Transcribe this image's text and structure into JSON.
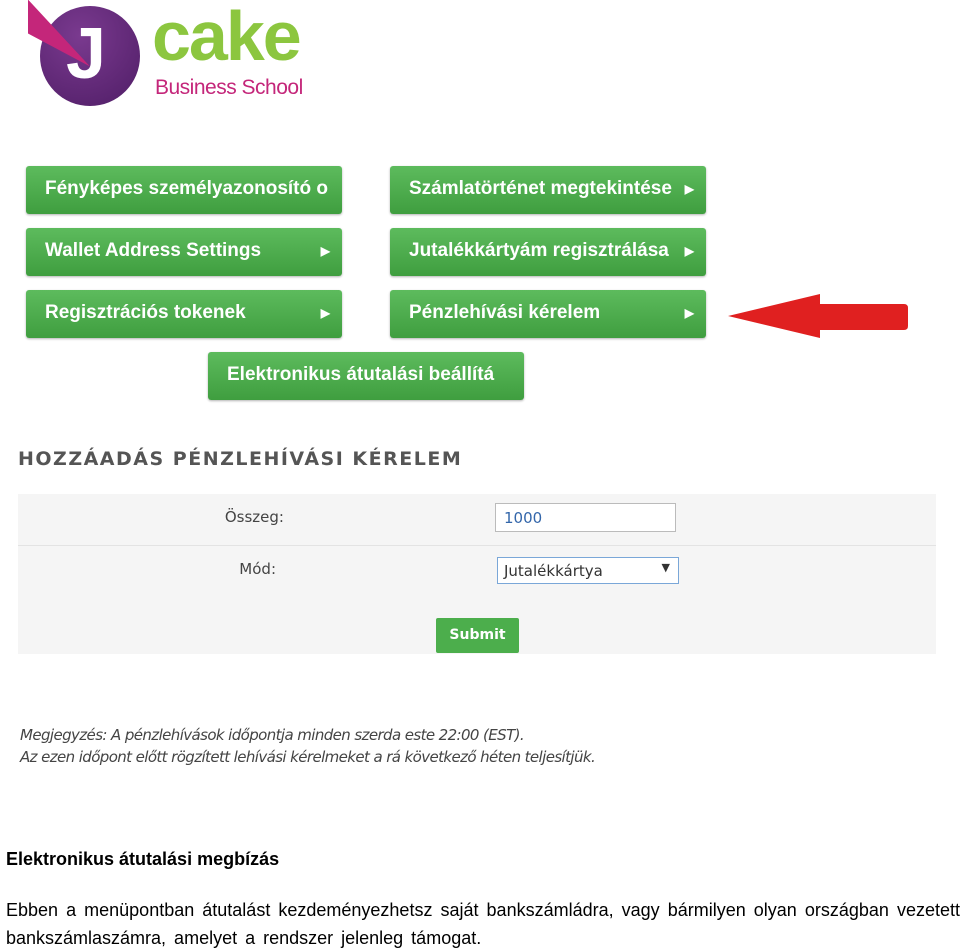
{
  "logo": {
    "brand": "cake",
    "subtitle": "Business School",
    "letter": "J"
  },
  "menu": [
    {
      "label": "Fényképes személyazonosító o"
    },
    {
      "label": "Számlatörténet megtekintése"
    },
    {
      "label": "Wallet Address Settings"
    },
    {
      "label": "Jutalékkártyám regisztrálása"
    },
    {
      "label": "Regisztrációs tokenek"
    },
    {
      "label": "Pénzlehívási kérelem"
    },
    {
      "label": "Elektronikus átutalási beállítá"
    }
  ],
  "form": {
    "title": "HOZZÁADÁS PÉNZLEHÍVÁSI KÉRELEM",
    "amount_label": "Összeg:",
    "amount_value": "1000",
    "mode_label": "Mód:",
    "mode_value": "Jutalékkártya",
    "submit": "Submit"
  },
  "note": {
    "line1": "Megjegyzés: A pénzlehívások időpontja minden szerda este 22:00 (EST).",
    "line2": "Az ezen időpont előtt rögzített lehívási kérelmeket a rá következő héten teljesítjük."
  },
  "document": {
    "heading": "Elektronikus átutalási megbízás",
    "paragraph": "Ebben a menüpontban átutalást kezdeményezhetsz saját bankszámládra, vagy bármilyen olyan országban vezetett bankszámlaszámra, amelyet a rendszer jelenleg támogat."
  },
  "colors": {
    "button_green": "#4cae4c",
    "arrow_red": "#e02020",
    "logo_purple": "#5a2473",
    "logo_green": "#8cc63f",
    "logo_pink": "#c4267a"
  }
}
